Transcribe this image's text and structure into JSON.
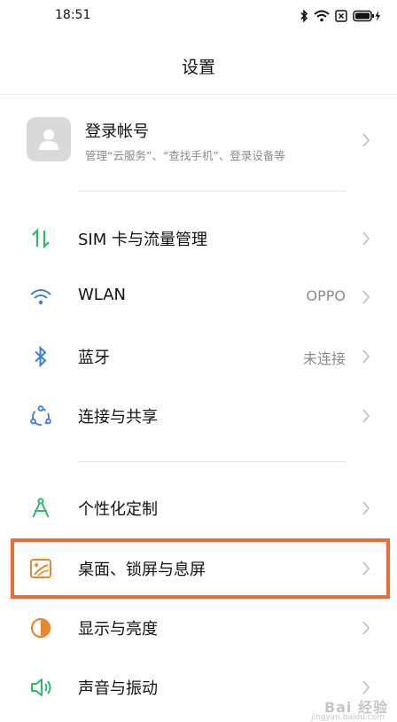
{
  "status_bar": {
    "time": "18:51",
    "icons": [
      "bluetooth-icon",
      "wifi-icon",
      "sim-x-icon",
      "battery-charging-icon"
    ]
  },
  "header": {
    "title": "设置"
  },
  "account": {
    "title": "登录帐号",
    "subtitle": "管理“云服务”、“查找手机”、登录设备等",
    "icon": "avatar-person-icon"
  },
  "settings": [
    {
      "key": "sim",
      "label": "SIM 卡与流量管理",
      "value": "",
      "icon": "sim-data-arrows-icon",
      "color": "#2fb86a"
    },
    {
      "key": "wlan",
      "label": "WLAN",
      "value": "OPPO",
      "icon": "wifi-icon",
      "color": "#3a7be0"
    },
    {
      "key": "bluetooth",
      "label": "蓝牙",
      "value": "未连接",
      "icon": "bluetooth-icon",
      "color": "#3a7be0"
    },
    {
      "key": "connection",
      "label": "连接与共享",
      "value": "",
      "icon": "connection-share-icon",
      "color": "#3a7be0"
    },
    {
      "key": "personalize",
      "label": "个性化定制",
      "value": "",
      "icon": "compass-icon",
      "color": "#2fb86a"
    },
    {
      "key": "desktop",
      "label": "桌面、锁屏与息屏",
      "value": "",
      "icon": "wallpaper-icon",
      "color": "#e8872f"
    },
    {
      "key": "display",
      "label": "显示与亮度",
      "value": "",
      "icon": "brightness-icon",
      "color": "#e8872f"
    },
    {
      "key": "sound",
      "label": "声音与振动",
      "value": "",
      "icon": "speaker-icon",
      "color": "#2fb86a"
    }
  ],
  "highlight_color": "#ec6b3a",
  "watermark": {
    "text": "Bai 经验",
    "sub": "jingyan.baidu.com"
  }
}
